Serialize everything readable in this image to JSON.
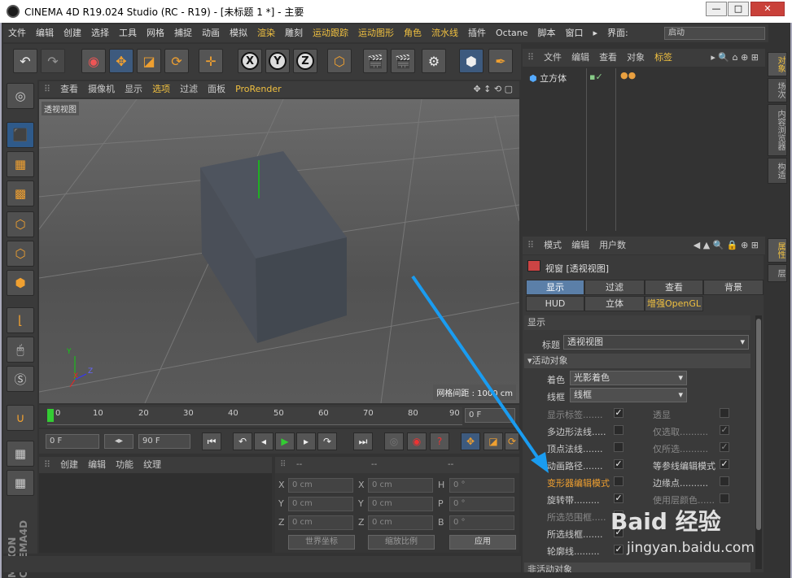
{
  "window": {
    "title": "CINEMA 4D R19.024 Studio (RC - R19) - [未标题 1 *] - 主要",
    "min": "—",
    "max": "□",
    "close": "✕"
  },
  "menubar": {
    "items": [
      "文件",
      "编辑",
      "创建",
      "选择",
      "工具",
      "网格",
      "捕捉",
      "动画",
      "模拟",
      "渲染",
      "雕刻",
      "运动跟踪",
      "运动图形",
      "角色",
      "流水线",
      "插件",
      "Octane",
      "脚本",
      "窗口",
      "▸",
      "界面:"
    ],
    "layout_value": "启动"
  },
  "viewport": {
    "menu": [
      "查看",
      "摄像机",
      "显示",
      "选项",
      "过滤",
      "面板",
      "ProRender"
    ],
    "label": "透视视图",
    "grid_readout": "网格间距 : 1000 cm",
    "axis": {
      "x": "X",
      "y": "Y",
      "z": "Z"
    }
  },
  "timeline": {
    "ticks": [
      "0",
      "10",
      "20",
      "30",
      "40",
      "50",
      "60",
      "70",
      "80",
      "90"
    ],
    "current_frame": "0 F",
    "start": "0 F",
    "end": "90 F"
  },
  "material": {
    "menu": [
      "创建",
      "编辑",
      "功能",
      "纹理"
    ]
  },
  "coords": {
    "headers": [
      "--",
      "--",
      "--"
    ],
    "rows": [
      {
        "a": "X",
        "av": "0 cm",
        "b": "X",
        "bv": "0 cm",
        "c": "H",
        "cv": "0 °"
      },
      {
        "a": "Y",
        "av": "0 cm",
        "b": "Y",
        "bv": "0 cm",
        "c": "P",
        "cv": "0 °"
      },
      {
        "a": "Z",
        "av": "0 cm",
        "b": "Z",
        "bv": "0 cm",
        "c": "B",
        "cv": "0 °"
      }
    ],
    "world": "世界坐标",
    "scale": "缩放比例",
    "apply": "应用"
  },
  "objmgr": {
    "menu": [
      "文件",
      "编辑",
      "查看",
      "对象",
      "标签"
    ],
    "object": "立方体"
  },
  "side_tabs": [
    "对象",
    "场次",
    "内容浏览器",
    "构造"
  ],
  "side_tabs2": [
    "属性",
    "层"
  ],
  "attr": {
    "menu": [
      "模式",
      "编辑",
      "用户数"
    ],
    "title": "视窗 [透视视图]",
    "tabs_row1": [
      "显示",
      "过滤",
      "查看",
      "背景"
    ],
    "tabs_row2": [
      "HUD",
      "立体",
      "增强OpenGL"
    ],
    "section": "显示",
    "title_label": "标题",
    "title_value": "透视视图",
    "active_obj": "▾活动对象",
    "shading_label": "着色",
    "shading_value": "光影着色",
    "wire_label": "线框",
    "wire_value": "线框",
    "left_opts": [
      "显示标签.......",
      "多边形法线.....",
      "顶点法线.......",
      "动画路径.......",
      "变形器编辑模式",
      "旋转带.........",
      "所选范围框.....",
      "所选线框.......",
      "轮廓线........."
    ],
    "right_opts": [
      "透显",
      "仅选取..........",
      "仅所选..........",
      "等参线编辑模式",
      "边缘点..........",
      "使用层颜色......"
    ],
    "next_section": "非活动对象"
  },
  "watermark": {
    "main": "Baid 经验",
    "sub": "jingyan.baidu.com"
  }
}
